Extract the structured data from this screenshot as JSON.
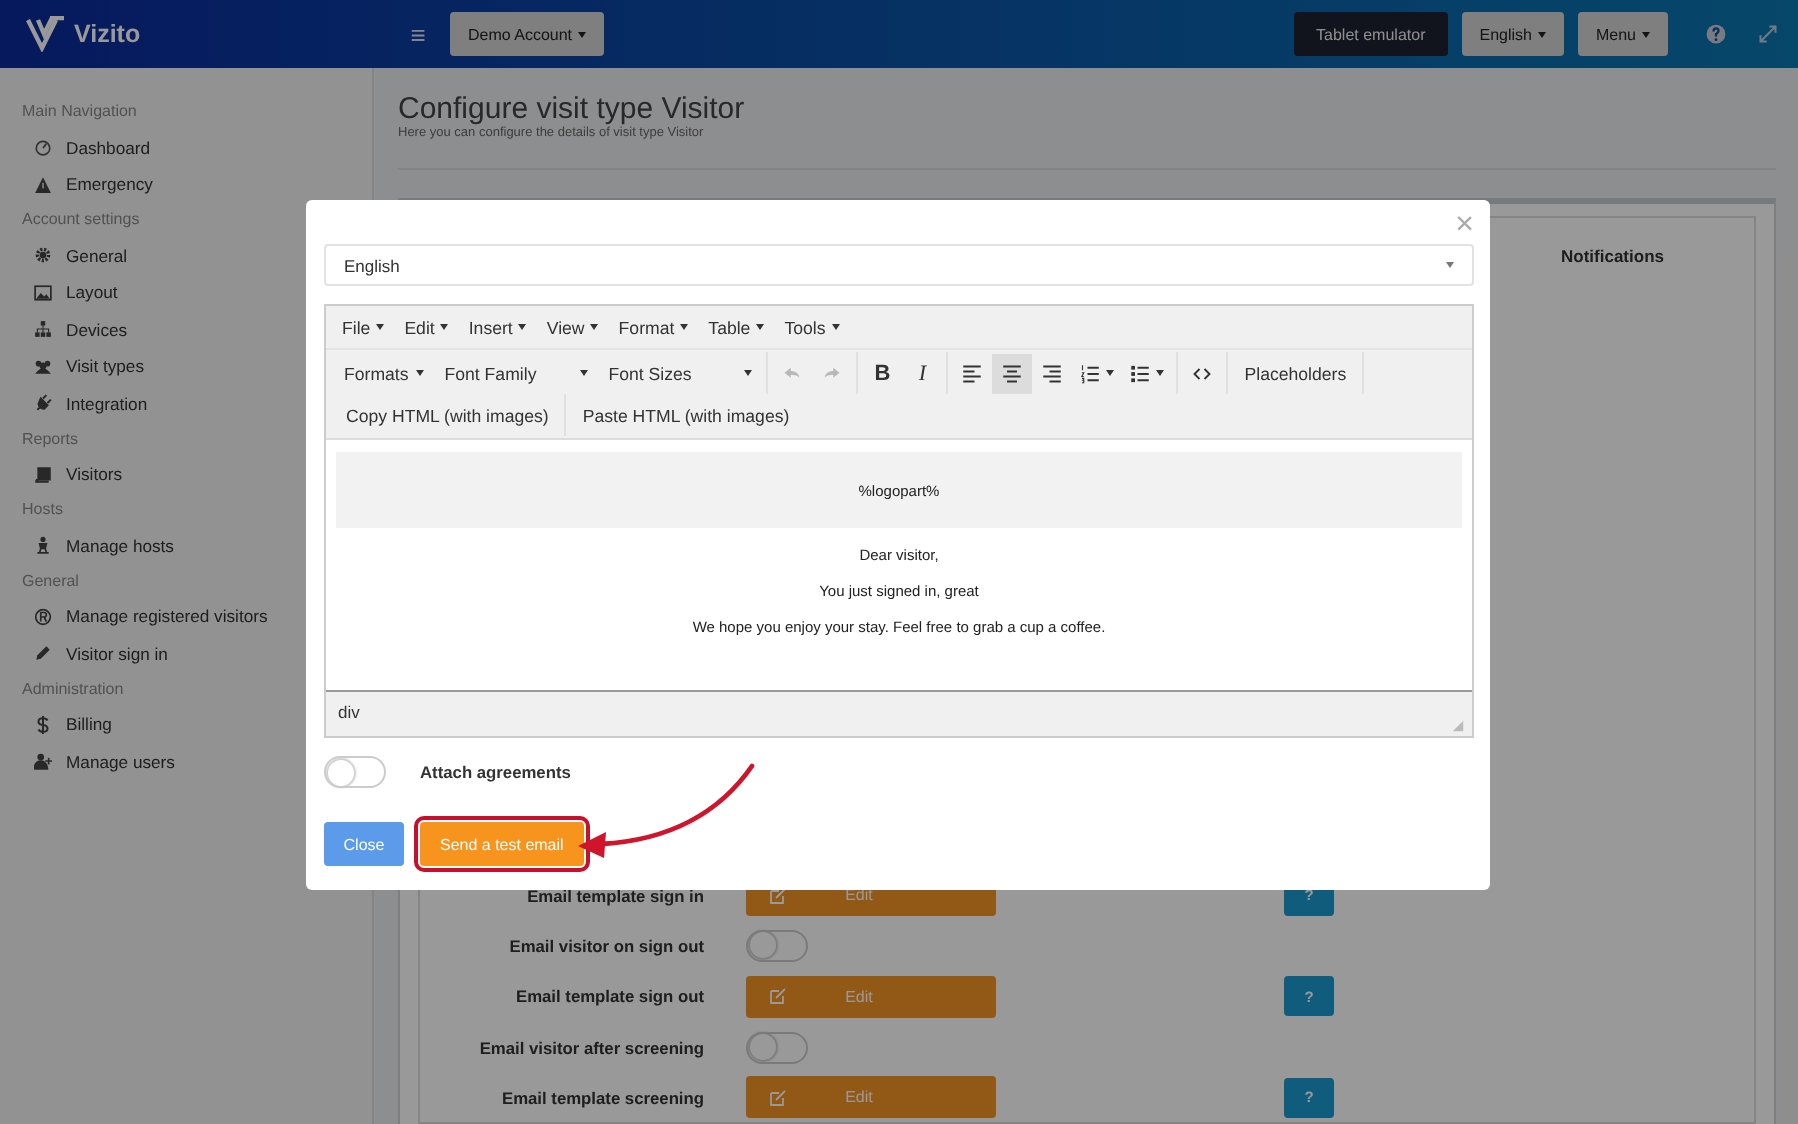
{
  "header": {
    "logo": "Vizito",
    "menu_icon": "≡",
    "account": "Demo Account",
    "buttons": [
      {
        "label": "Tablet emulator",
        "kind": "dark"
      },
      {
        "label": "English",
        "kind": "dropdown"
      },
      {
        "label": "Menu",
        "kind": "dropdown"
      }
    ]
  },
  "sidebar": {
    "sections": [
      {
        "title": "Main Navigation",
        "items": [
          "Dashboard",
          "Emergency"
        ]
      },
      {
        "title": "Account settings",
        "items": [
          "General",
          "Layout",
          "Devices",
          "Visit types",
          "Integration"
        ]
      },
      {
        "title": "Reports",
        "items": [
          "Visitors"
        ]
      },
      {
        "title": "Hosts",
        "items": [
          "Manage hosts"
        ]
      },
      {
        "title": "General",
        "items": [
          "Manage registered visitors",
          "Visitor sign in"
        ]
      },
      {
        "title": "Administration",
        "items": [
          "Billing",
          "Manage users"
        ]
      }
    ]
  },
  "page": {
    "title": "Configure visit type Visitor",
    "subtitle": "Here you can configure the details of visit type Visitor",
    "tab_heading": "Notifications",
    "rows": [
      {
        "kind": "template",
        "label": "Email template sign in",
        "button": "Edit",
        "help": "?"
      },
      {
        "kind": "toggle",
        "label": "Email visitor on sign out",
        "on": false
      },
      {
        "kind": "template",
        "label": "Email template sign out",
        "button": "Edit",
        "help": "?"
      },
      {
        "kind": "toggle",
        "label": "Email visitor after screening",
        "on": false
      },
      {
        "kind": "template",
        "label": "Email template screening",
        "button": "Edit",
        "help": "?"
      }
    ]
  },
  "modal": {
    "close": "×",
    "language": "English",
    "menus": [
      "File",
      "Edit",
      "Insert",
      "View",
      "Format",
      "Table",
      "Tools"
    ],
    "toolbar": [
      [
        {
          "kind": "dropdown",
          "label": "Formats"
        },
        {
          "kind": "wide-dropdown",
          "label": "Font Family"
        },
        {
          "kind": "wide-dropdown",
          "label": "Font Sizes"
        }
      ],
      [
        {
          "kind": "undo",
          "disabled": true
        },
        {
          "kind": "redo",
          "disabled": true
        }
      ],
      [
        {
          "kind": "bold",
          "label": "B"
        },
        {
          "kind": "italic",
          "label": "I"
        }
      ],
      [
        {
          "kind": "align-left",
          "selected": false
        },
        {
          "kind": "align-center",
          "selected": true
        },
        {
          "kind": "align-right",
          "selected": false
        },
        {
          "kind": "numlist"
        },
        {
          "kind": "bullist"
        }
      ],
      [
        {
          "kind": "code"
        }
      ],
      [
        {
          "kind": "text",
          "label": "Placeholders"
        }
      ],
      [
        {
          "kind": "text",
          "label": "Copy HTML (with images)"
        }
      ],
      [
        {
          "kind": "text",
          "label": "Paste HTML (with images)"
        }
      ]
    ],
    "content": {
      "logo": "%logopart%",
      "paragraphs": [
        "Dear visitor,",
        "You just signed in, great",
        "We hope you enjoy your stay. Feel free to grab a cup a coffee."
      ]
    },
    "path": "div",
    "attach": {
      "label": "Attach agreements",
      "on": false
    },
    "buttons": [
      {
        "label": "Close",
        "kind": "primary",
        "highlighted": false
      },
      {
        "label": "Send a test email",
        "kind": "warning",
        "highlighted": true
      }
    ]
  }
}
